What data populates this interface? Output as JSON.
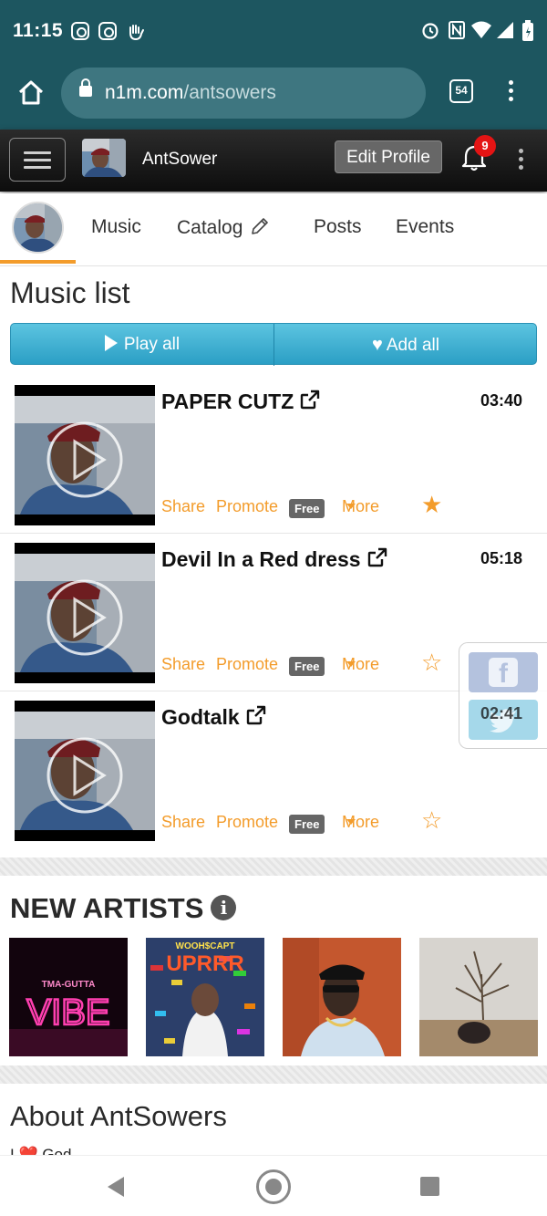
{
  "status_bar": {
    "time": "11:15",
    "left_icons": [
      "instagram-icon",
      "instagram-icon",
      "hand-wave-icon"
    ],
    "right_icons": [
      "alarm-icon",
      "nfc-icon",
      "wifi-icon",
      "signal-icon",
      "battery-icon"
    ]
  },
  "browser": {
    "url_host": "n1m.com",
    "url_path": "/antsowers",
    "tab_count": "54"
  },
  "header": {
    "username": "AntSower",
    "edit_profile_label": "Edit Profile",
    "notification_count": "9"
  },
  "tabs": [
    {
      "label": "Music",
      "active": true
    },
    {
      "label": "Catalog",
      "active": false
    },
    {
      "label": "Posts",
      "active": false
    },
    {
      "label": "Events",
      "active": false
    }
  ],
  "music_list": {
    "title": "Music list",
    "play_all_label": "Play all",
    "add_all_label": "Add all",
    "tracks": [
      {
        "title": "PAPER CUTZ",
        "duration": "03:40",
        "share": "Share",
        "promote": "Promote",
        "free": "Free",
        "more": "More",
        "starred": true
      },
      {
        "title": "Devil In a Red dress",
        "duration": "05:18",
        "share": "Share",
        "promote": "Promote",
        "free": "Free",
        "more": "More",
        "starred": false
      },
      {
        "title": "Godtalk",
        "duration": "02:41",
        "share": "Share",
        "promote": "Promote",
        "free": "Free",
        "more": "More",
        "starred": false
      }
    ]
  },
  "new_artists": {
    "title": "NEW ARTISTS",
    "items": [
      {
        "cover_text_top": "TMA-GUTTA",
        "cover_text_main": "VIBE"
      },
      {
        "cover_text_top": "WOOH$CAPT",
        "cover_text_main": "UPRRR"
      },
      {
        "cover_text_top": "",
        "cover_text_main": ""
      },
      {
        "cover_text_top": "",
        "cover_text_main": ""
      }
    ]
  },
  "about": {
    "title": "About AntSowers",
    "text_start": "I ❤️ God"
  },
  "colors": {
    "chrome": "#1d5660",
    "accent_orange": "#f39c2b",
    "play_button": "#3aaed3"
  }
}
